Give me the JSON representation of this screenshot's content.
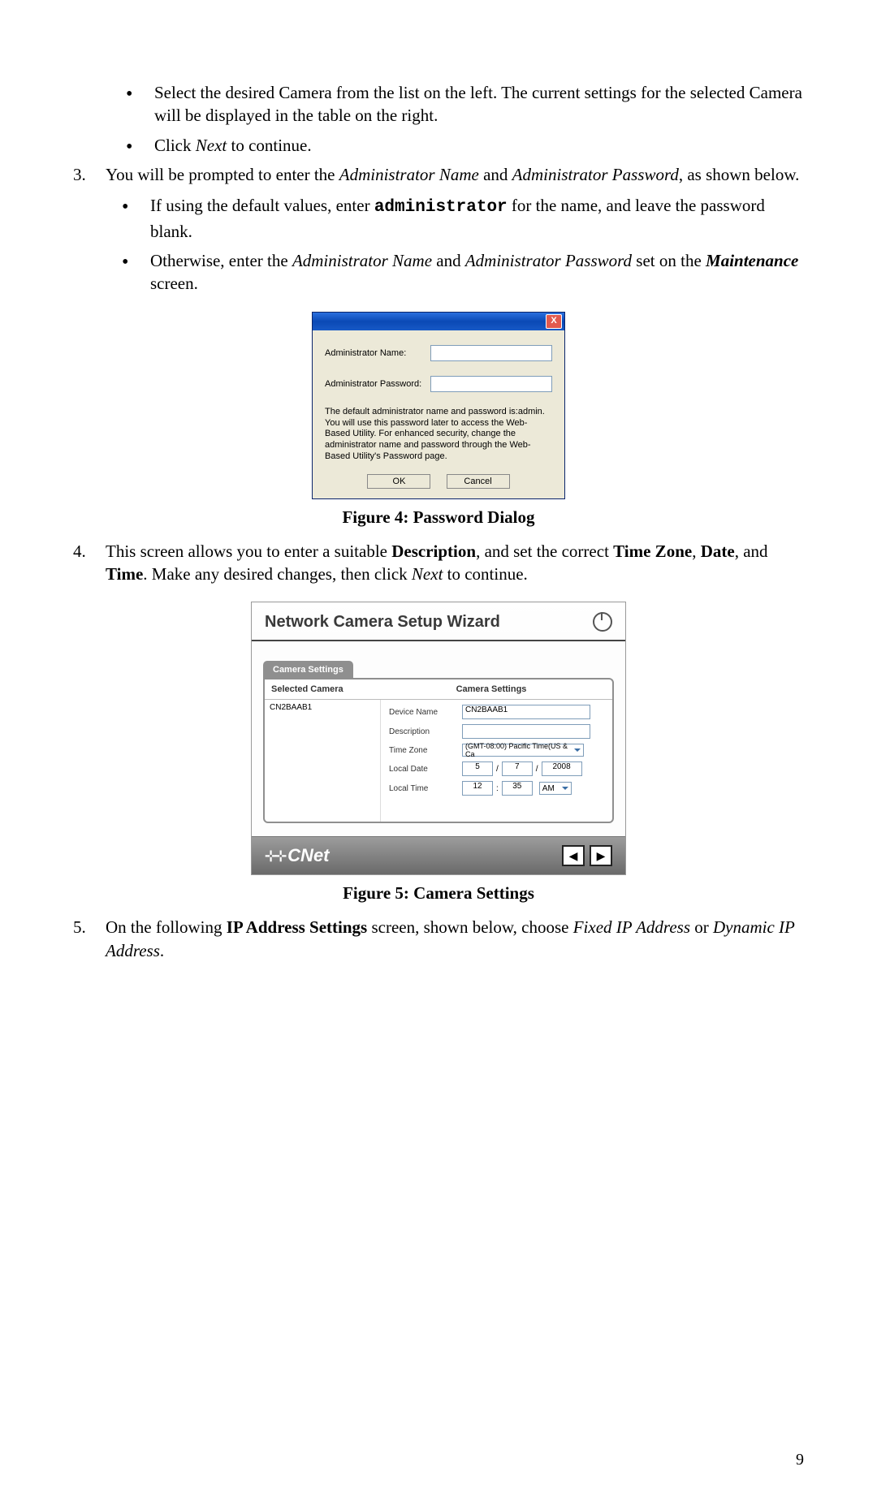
{
  "bullets_top": [
    "Select the desired Camera from the list on the left. The current settings for the selected Camera will be displayed in the table on the right.",
    "Click __ITALIC_Next__ to continue."
  ],
  "step3": {
    "text_before": "You will be prompted to enter the ",
    "admin_name_label": "Administrator Name",
    "and1": " and ",
    "admin_pass_label": "Administrator Password",
    "text_after": ", as shown below.",
    "bullets": {
      "b1_a": "If using the default values, enter ",
      "b1_code": "administrator",
      "b1_b": " for the name, and leave the password blank.",
      "b2_a": "Otherwise, enter the ",
      "b2_b": " set on the ",
      "b2_maint": "Maintenance",
      "b2_c": " screen."
    }
  },
  "dialog": {
    "close": "X",
    "name_label": "Administrator Name:",
    "pass_label": "Administrator Password:",
    "name_value": "",
    "pass_value": "",
    "note": "The default administrator name and password is:admin. You will use this password later to access the Web-Based Utility. For enhanced security, change the administrator name and password through the Web-Based Utility's Password page.",
    "ok": "OK",
    "cancel": "Cancel"
  },
  "fig4_caption": "Figure 4: Password Dialog",
  "step4": {
    "a": "This screen allows you to enter a suitable ",
    "desc": "Description",
    "b": ", and set the correct ",
    "tz": "Time Zone",
    "c": ", ",
    "date": "Date",
    "d": ", and ",
    "time": "Time",
    "e": ". Make any desired changes, then click ",
    "next": "Next",
    "f": " to continue."
  },
  "wizard": {
    "title": "Network Camera Setup Wizard",
    "tab": "Camera Settings",
    "col1": "Selected Camera",
    "col2": "Camera Settings",
    "selected_camera": "CN2BAAB1",
    "rows": {
      "device_name": "Device Name",
      "device_name_val": "CN2BAAB1",
      "description": "Description",
      "description_val": "",
      "timezone": "Time Zone",
      "timezone_val": "(GMT-08:00) Pacific Time(US & Ca",
      "local_date": "Local Date",
      "date_m": "5",
      "date_d": "7",
      "date_y": "2008",
      "local_time": "Local Time",
      "time_h": "12",
      "time_m": "35",
      "time_ampm": "AM"
    },
    "logo": "CNet",
    "prev": "◀",
    "next": "▶"
  },
  "fig5_caption": "Figure 5: Camera Settings",
  "step5": {
    "a": "On the following ",
    "ip": "IP Address Settings",
    "b": " screen, shown below, choose ",
    "fixed": "Fixed IP Address",
    "c": " or ",
    "dyn": "Dynamic IP Address",
    "d": "."
  },
  "page_number": "9"
}
